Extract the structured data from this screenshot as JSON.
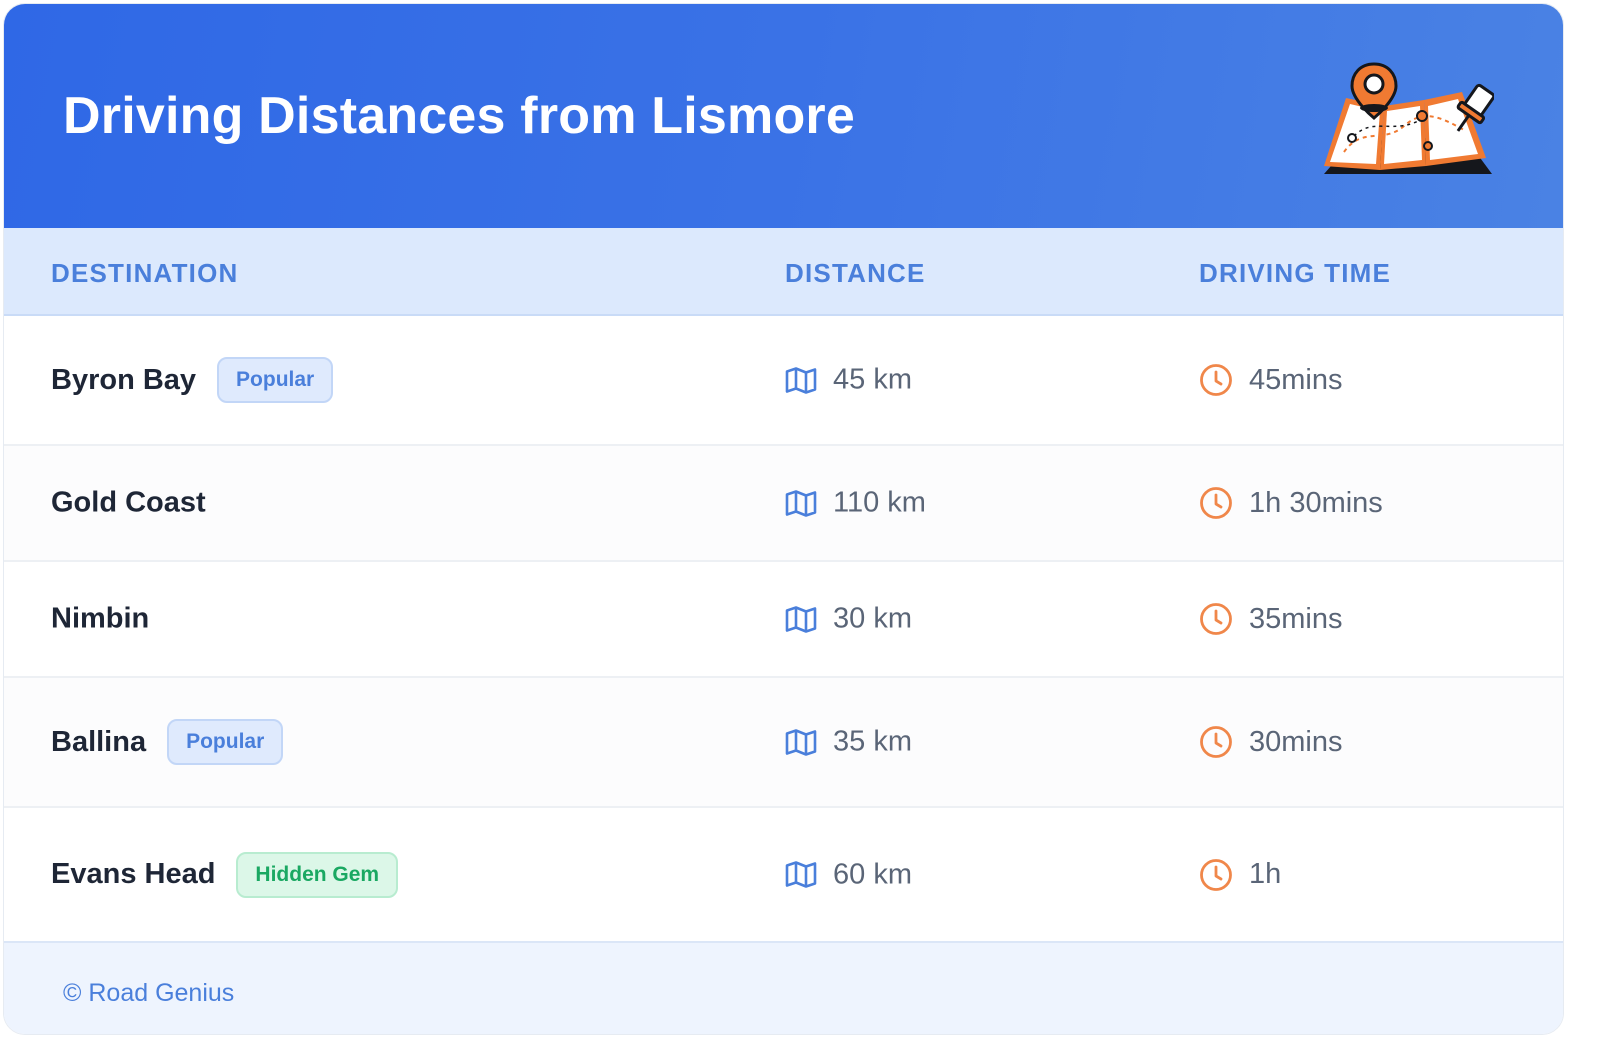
{
  "header": {
    "title": "Driving Distances from Lismore",
    "illustration": "map-with-pins-icon"
  },
  "table": {
    "columns": [
      "DESTINATION",
      "DISTANCE",
      "DRIVING TIME"
    ],
    "rows": [
      {
        "destination": "Byron Bay",
        "badge": "Popular",
        "badge_type": "popular",
        "distance": "45 km",
        "time": "45mins"
      },
      {
        "destination": "Gold Coast",
        "badge": "",
        "badge_type": "",
        "distance": "110 km",
        "time": "1h 30mins"
      },
      {
        "destination": "Nimbin",
        "badge": "",
        "badge_type": "",
        "distance": "30 km",
        "time": "35mins"
      },
      {
        "destination": "Ballina",
        "badge": "Popular",
        "badge_type": "popular",
        "distance": "35 km",
        "time": "30mins"
      },
      {
        "destination": "Evans Head",
        "badge": "Hidden Gem",
        "badge_type": "gem",
        "distance": "60 km",
        "time": "1h"
      }
    ]
  },
  "icons": {
    "distance": "map-icon",
    "time": "clock-icon"
  },
  "colors": {
    "header_gradient_start": "#2f68e6",
    "header_gradient_end": "#4a82e4",
    "accent_blue": "#4a7fdb",
    "accent_orange": "#f0874a",
    "gem_green": "#1aa862"
  },
  "footer": {
    "text": "© Road Genius"
  }
}
